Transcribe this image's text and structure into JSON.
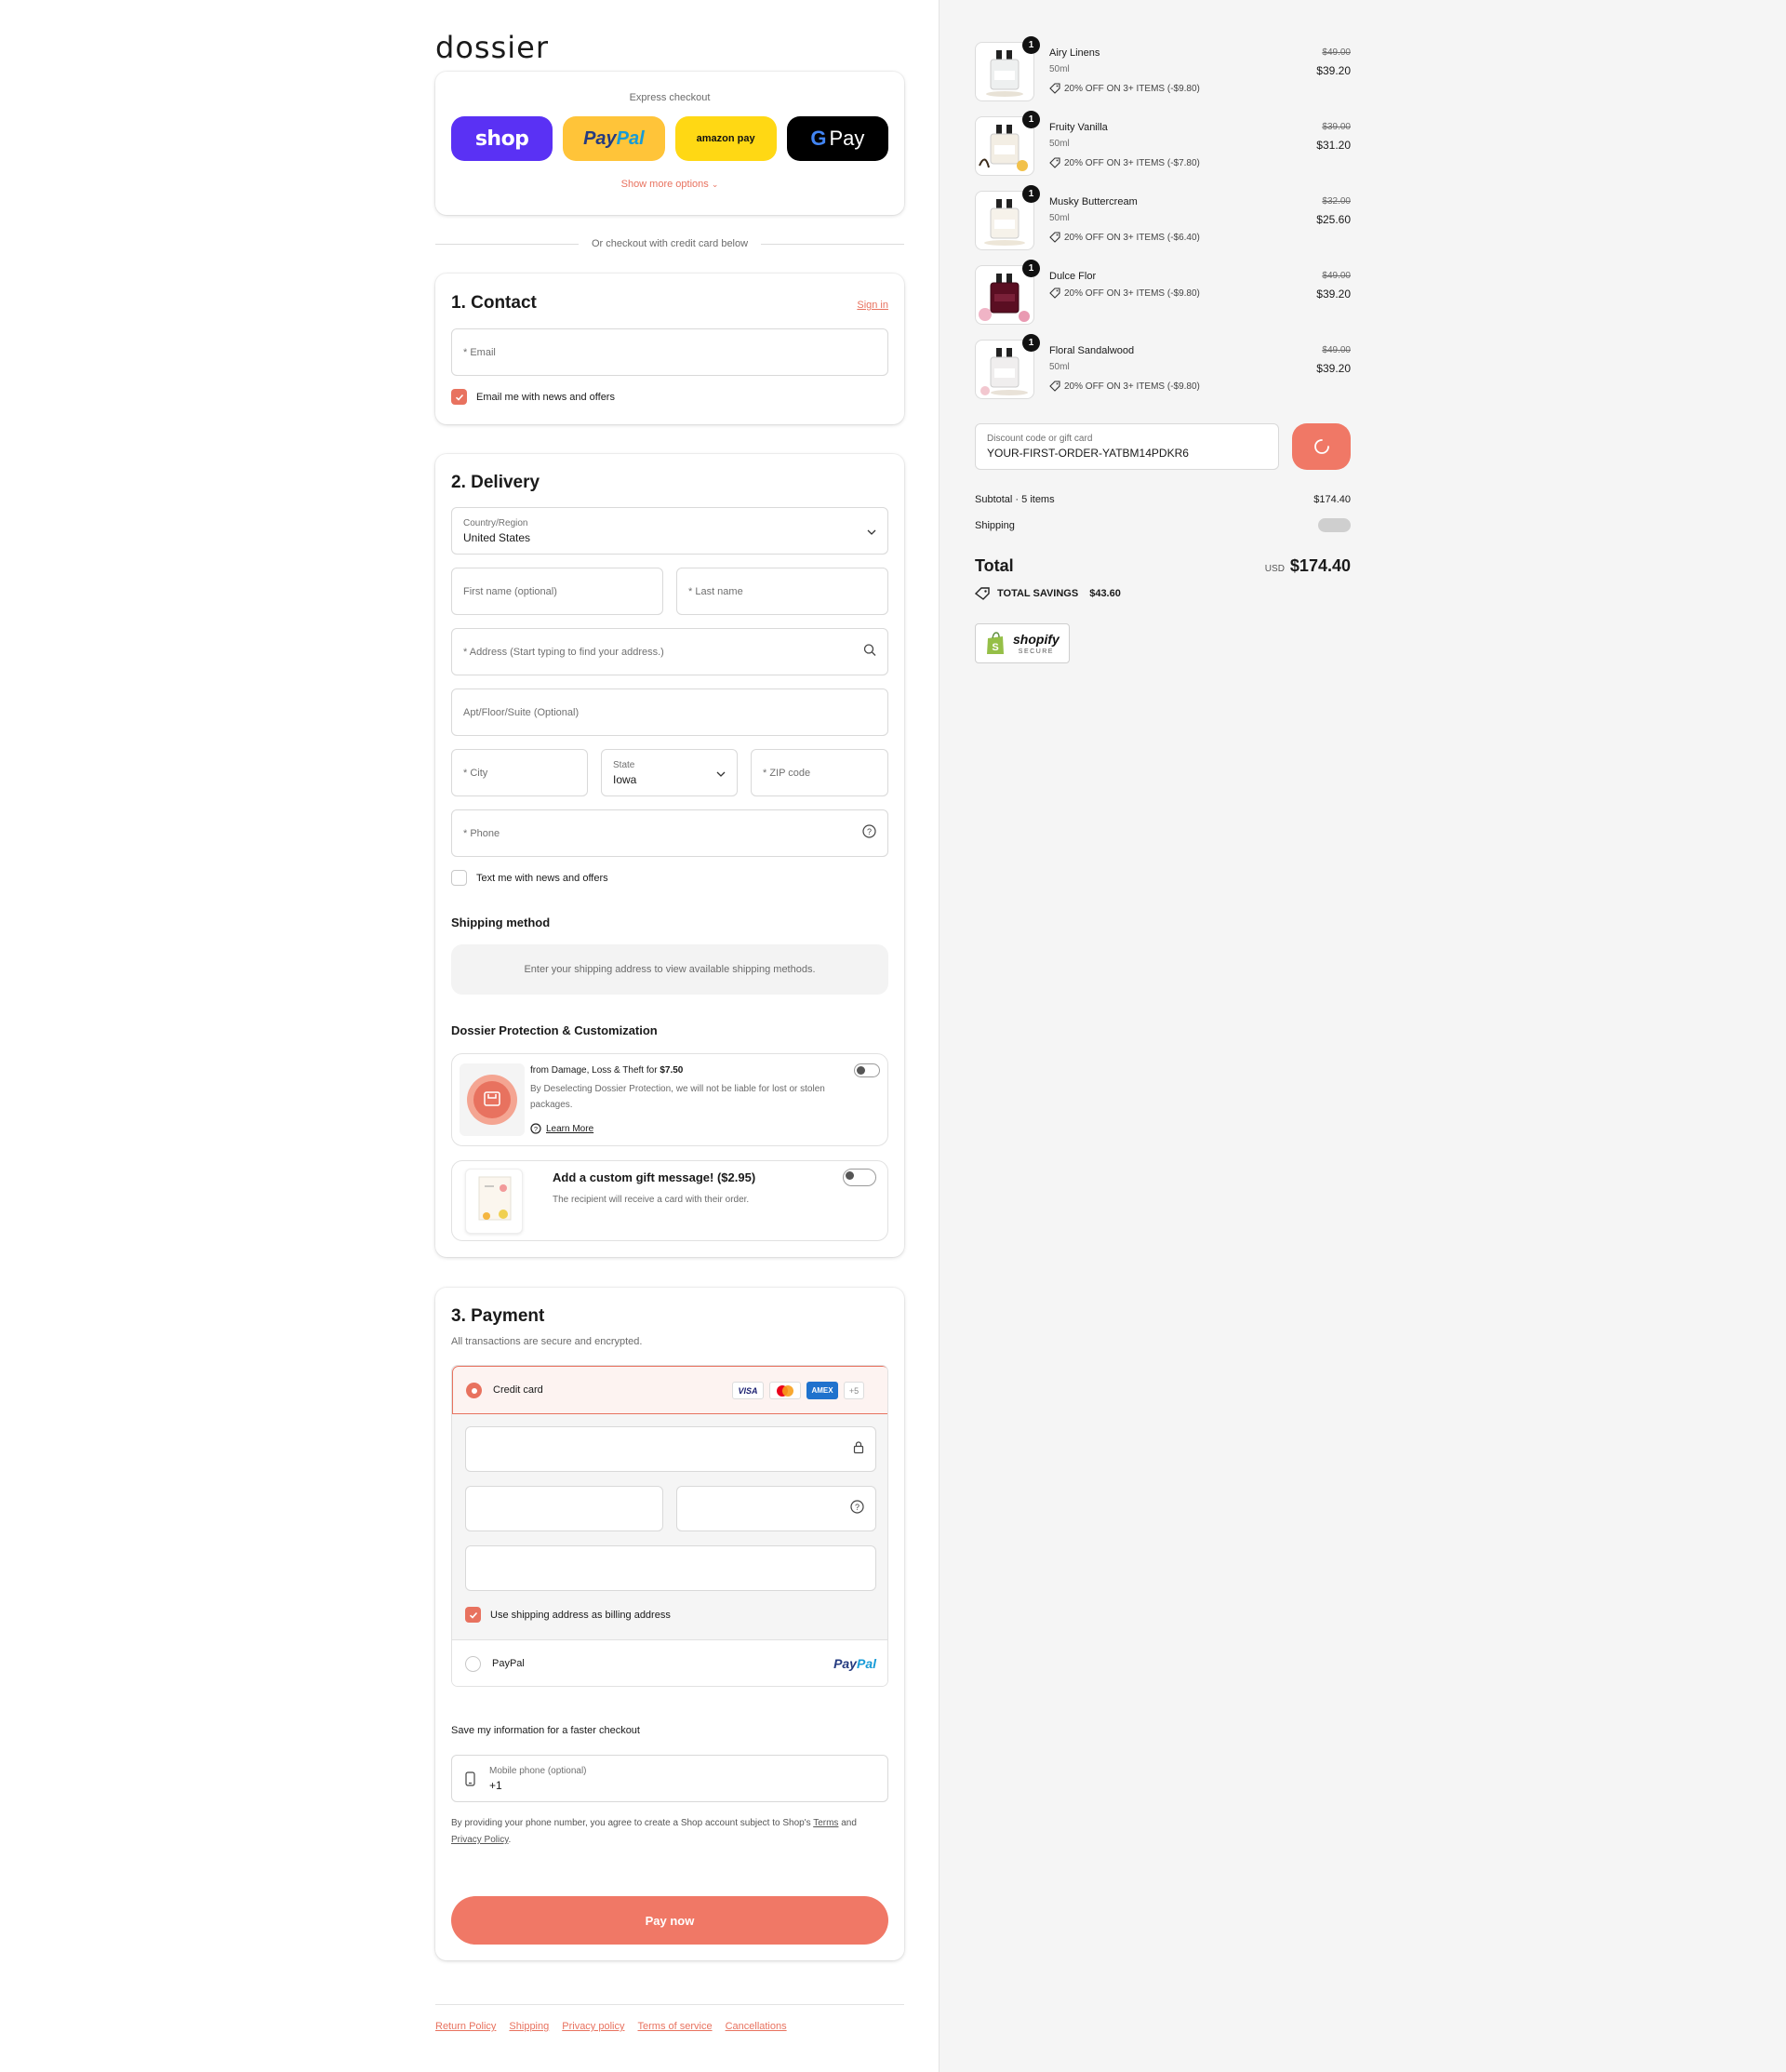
{
  "brand": {
    "logo": "dossier"
  },
  "express": {
    "title": "Express checkout",
    "shop_label": "shop",
    "paypal_label_1": "Pay",
    "paypal_label_2": "Pal",
    "amazon_label": "amazon pay",
    "gpay_label": "Pay",
    "show_more": "Show more options"
  },
  "or_divider": "Or checkout with credit card below",
  "contact": {
    "title": "1. Contact",
    "sign_in": "Sign in",
    "email_placeholder": "* Email",
    "news_label": "Email me with news and offers"
  },
  "delivery": {
    "title": "2. Delivery",
    "country_label": "Country/Region",
    "country_value": "United States",
    "first_name": "First name (optional)",
    "last_name": "* Last name",
    "address": "* Address (Start typing to find your address.)",
    "apt": "Apt/Floor/Suite (Optional)",
    "city": "* City",
    "state_label": "State",
    "state_value": "Iowa",
    "zip": "* ZIP code",
    "phone": "* Phone",
    "text_label": "Text me with news and offers",
    "shipping_method_title": "Shipping method",
    "shipping_method_msg": "Enter your shipping address to view available shipping methods.",
    "protection_title": "Dossier Protection & Customization",
    "protection_line_1": "from Damage, Loss & Theft for ",
    "protection_price": "$7.50",
    "protection_desc": "By Deselecting Dossier Protection, we will not be liable for lost or stolen packages.",
    "learn_more": "Learn More",
    "gift_title": "Add a custom gift message! ($2.95)",
    "gift_desc": "The recipient will receive a card with their order."
  },
  "payment": {
    "title": "3. Payment",
    "subtitle": "All transactions are secure and encrypted.",
    "credit_card_label": "Credit card",
    "card_visa": "VISA",
    "card_amex": "AMEX",
    "card_more": "+5",
    "billing_label": "Use shipping address as billing address",
    "paypal_label": "PayPal",
    "paypal_logo_1": "Pay",
    "paypal_logo_2": "Pal"
  },
  "save_info": {
    "title": "Save my information for a faster checkout",
    "mobile_label": "Mobile phone (optional)",
    "mobile_value": "+1",
    "terms_prefix": "By providing your phone number, you agree to create a Shop account subject to Shop's ",
    "terms_link": "Terms",
    "terms_and": " and",
    "privacy_link": "Privacy Policy",
    "terms_suffix": "."
  },
  "pay_now": "Pay now",
  "footer": [
    "Return Policy",
    "Shipping",
    "Privacy policy",
    "Terms of service",
    "Cancellations"
  ],
  "summary": {
    "items": [
      {
        "qty": "1",
        "name": "Airy Linens",
        "size": "50ml",
        "discount": "20% OFF ON 3+ ITEMS (-$9.80)",
        "old_price": "$49.00",
        "price": "$39.20"
      },
      {
        "qty": "1",
        "name": "Fruity Vanilla",
        "size": "50ml",
        "discount": "20% OFF ON 3+ ITEMS (-$7.80)",
        "old_price": "$39.00",
        "price": "$31.20"
      },
      {
        "qty": "1",
        "name": "Musky Buttercream",
        "size": "50ml",
        "discount": "20% OFF ON 3+ ITEMS (-$6.40)",
        "old_price": "$32.00",
        "price": "$25.60"
      },
      {
        "qty": "1",
        "name": "Dulce Flor",
        "size": "",
        "discount": "20% OFF ON 3+ ITEMS (-$9.80)",
        "old_price": "$49.00",
        "price": "$39.20"
      },
      {
        "qty": "1",
        "name": "Floral Sandalwood",
        "size": "50ml",
        "discount": "20% OFF ON 3+ ITEMS (-$9.80)",
        "old_price": "$49.00",
        "price": "$39.20"
      }
    ],
    "discount_label": "Discount code or gift card",
    "discount_value": "YOUR-FIRST-ORDER-YATBM14PDKR6",
    "subtotal_label": "Subtotal · 5 items",
    "subtotal_value": "$174.40",
    "shipping_label": "Shipping",
    "total_label": "Total",
    "currency": "USD",
    "total_value": "$174.40",
    "savings_label": "TOTAL SAVINGS",
    "savings_value": "$43.60",
    "shopify_label": "shopify",
    "shopify_secure": "SECURE"
  },
  "colors": {
    "accent": "#e8725f",
    "pay_button": "#f07866",
    "shop_purple": "#5a31f4",
    "paypal_yellow": "#ffc439",
    "amazon_yellow": "#ffd814"
  }
}
